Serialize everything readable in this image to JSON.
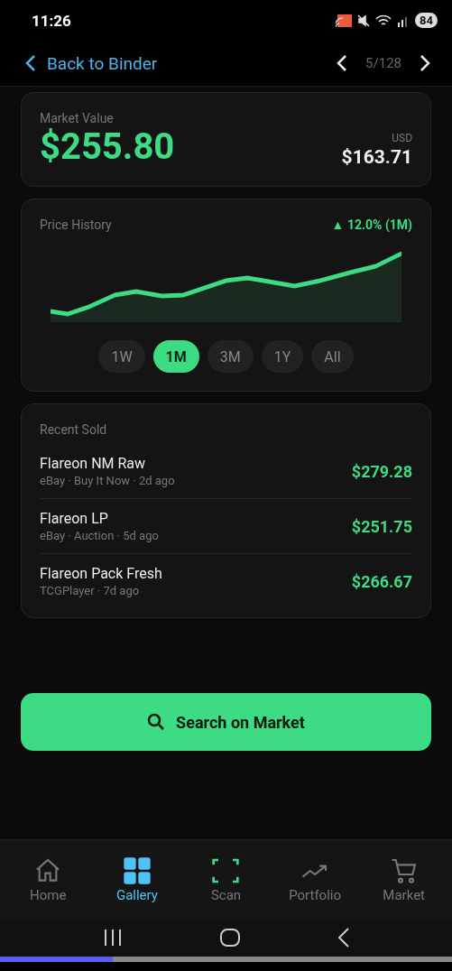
{
  "status_bar": {
    "time": "11:26",
    "battery": "84"
  },
  "header": {
    "back_label": "Back to Binder",
    "counter": "5/128"
  },
  "market_value": {
    "label": "Market Value",
    "value": "$255.80",
    "currency": "USD",
    "secondary_value": "$163.71"
  },
  "price_history": {
    "title": "Price History",
    "change": "▲ 12.0% (1M)",
    "ranges": [
      {
        "label": "1W",
        "selected": false
      },
      {
        "label": "1M",
        "selected": true
      },
      {
        "label": "3M",
        "selected": false
      },
      {
        "label": "1Y",
        "selected": false
      },
      {
        "label": "All",
        "selected": false
      }
    ]
  },
  "recent_sold": {
    "title": "Recent Sold",
    "items": [
      {
        "name": "Flareon NM Raw",
        "details": "eBay · Buy It Now · 2d ago",
        "price": "$279.28"
      },
      {
        "name": "Flareon LP",
        "details": "eBay · Auction · 5d ago",
        "price": "$251.75"
      },
      {
        "name": "Flareon Pack Fresh",
        "details": "TCGPlayer · 7d ago",
        "price": "$266.67"
      }
    ]
  },
  "search_button": "Search on Market",
  "bottom_nav": [
    {
      "label": "Home",
      "kind": "home",
      "selected": false
    },
    {
      "label": "Gallery",
      "kind": "gallery",
      "selected": true
    },
    {
      "label": "Scan",
      "kind": "scan",
      "selected": false
    },
    {
      "label": "Portfolio",
      "kind": "portfolio",
      "selected": false
    },
    {
      "label": "Market",
      "kind": "market",
      "selected": false
    }
  ],
  "playback_bar": {
    "level": 0.25
  }
}
